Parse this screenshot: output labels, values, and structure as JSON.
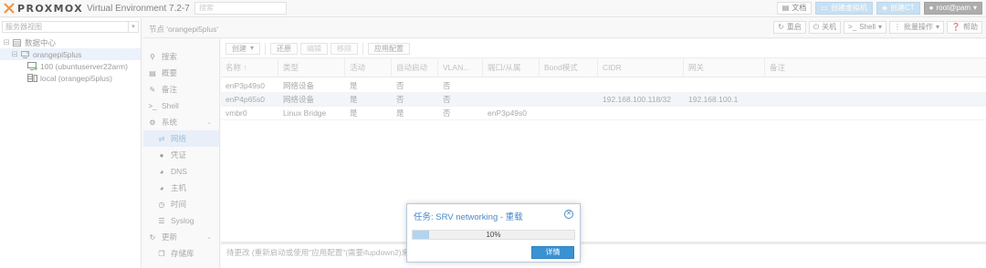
{
  "topbar": {
    "logo_text": "PROXMOX",
    "version": "Virtual Environment 7.2-7",
    "search_placeholder": "搜索",
    "docs_label": "文档",
    "create_vm_label": "创建虚拟机",
    "create_ct_label": "创建CT",
    "user_label": "root@pam"
  },
  "tree": {
    "view_label": "服务器视图",
    "items": [
      {
        "label": "数据中心"
      },
      {
        "label": "orangepi5plus"
      },
      {
        "label": "100 (ubuntuserver22arm)"
      },
      {
        "label": "local (orangepi5plus)"
      }
    ]
  },
  "content_header": {
    "title": "节点 'orangepi5plus'",
    "buttons": {
      "reboot": "重启",
      "shutdown": "关机",
      "shell": "Shell",
      "bulk": "批量操作",
      "help": "帮助"
    }
  },
  "nav": {
    "search": "搜索",
    "summary": "概要",
    "notes": "备注",
    "shell": "Shell",
    "system": "系统",
    "network": "网络",
    "certificates": "凭证",
    "dns": "DNS",
    "hosts": "主机",
    "time": "时间",
    "syslog": "Syslog",
    "updates": "更新",
    "repositories": "存储库"
  },
  "toolbar": {
    "create": "创建",
    "revert": "还原",
    "edit": "编辑",
    "remove": "移除",
    "apply": "应用配置"
  },
  "table": {
    "headers": [
      "名称 ↑",
      "类型",
      "活动",
      "自动启动",
      "VLAN...",
      "端口/从属",
      "Bond模式",
      "CIDR",
      "网关",
      "备注"
    ],
    "rows": [
      [
        "enP3p49s0",
        "网络设备",
        "是",
        "否",
        "否",
        "",
        "",
        "",
        "",
        ""
      ],
      [
        "enP4p65s0",
        "网络设备",
        "是",
        "否",
        "否",
        "",
        "",
        "192.168.100.118/32",
        "192.168.100.1",
        ""
      ],
      [
        "vmbr0",
        "Linux Bridge",
        "是",
        "是",
        "否",
        "enP3p49s0",
        "",
        "",
        "",
        ""
      ]
    ]
  },
  "pending": {
    "text": "待更改 (重新启动或使用\"应用配置\"(需要ifupdown2)来..."
  },
  "dialog": {
    "title": "任务: SRV networking - 重载",
    "progress_text": "10%",
    "progress_fraction": 0.1,
    "button": "详情"
  }
}
